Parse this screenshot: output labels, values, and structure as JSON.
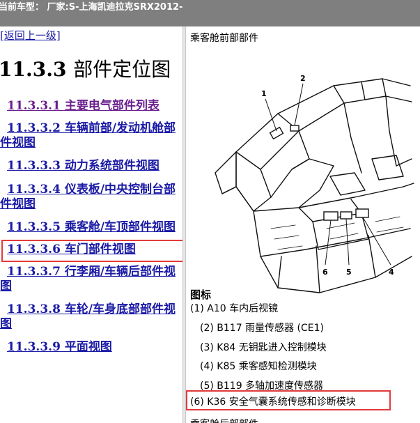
{
  "topbar": {
    "text": "当前车型： 厂家:S-上海凯迪拉克SRX2012-"
  },
  "left": {
    "back_link": "[返回上一级]",
    "heading_num": "11.3.3",
    "heading_text": "部件定位图",
    "toc": [
      {
        "label": "11.3.3.1 主要电气部件列表"
      },
      {
        "label": "11.3.3.2 车辆前部/发动机舱部件视图"
      },
      {
        "label": "11.3.3.3 动力系统部件视图"
      },
      {
        "label": "11.3.3.4 仪表板/中央控制台部件视图"
      },
      {
        "label": "11.3.3.5 乘客舱/车顶部件视图"
      },
      {
        "label": "11.3.3.6 车门部件视图"
      },
      {
        "label": "11.3.3.7 行李厢/车辆后部件视图"
      },
      {
        "label": "11.3.3.8 车轮/车身底部部件视图"
      },
      {
        "label": "11.3.3.9 平面视图"
      }
    ]
  },
  "right": {
    "section_title": "乘客舱前部部件",
    "callouts": [
      "1",
      "2",
      "6",
      "5",
      "4"
    ],
    "legend_title": "图标",
    "legend": [
      "(1) A10 车内后视镜",
      "(2) B117 雨量传感器 (CE1)",
      "(3) K84 无钥匙进入控制模块",
      "(4) K85 乘客感知检测模块",
      "(5) B119 多轴加速度传感器",
      "(6) K36 安全气囊系统传感和诊断模块"
    ],
    "cut_text": "乘客舱后部部件"
  },
  "colors": {
    "link": "#1a1aa6",
    "visited": "#6b1f8f",
    "highlight": "#e23b3b",
    "topbar": "#7f7f7f"
  }
}
